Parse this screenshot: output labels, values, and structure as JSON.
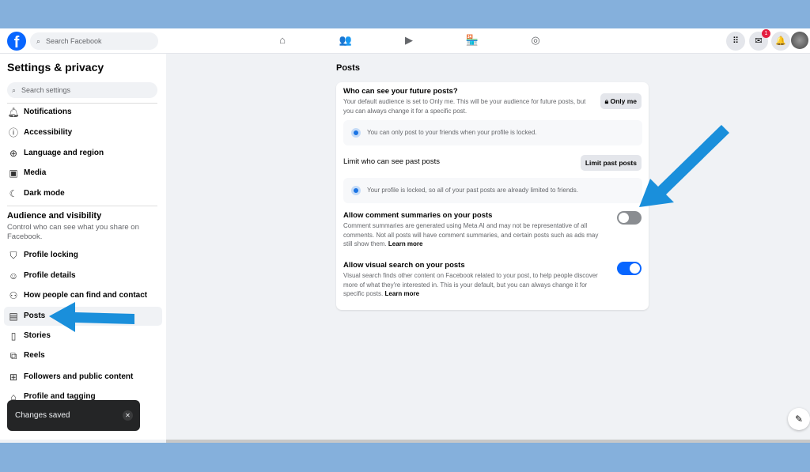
{
  "header": {
    "search_placeholder": "Search Facebook",
    "messenger_badge": "1"
  },
  "sidebar": {
    "title": "Settings & privacy",
    "search_placeholder": "Search settings",
    "items": [
      {
        "label": "Notifications",
        "icon": "bell"
      },
      {
        "label": "Accessibility",
        "icon": "accessibility"
      },
      {
        "label": "Language and region",
        "icon": "globe"
      },
      {
        "label": "Media",
        "icon": "media"
      },
      {
        "label": "Dark mode",
        "icon": "moon"
      }
    ],
    "section": {
      "title": "Audience and visibility",
      "subtitle": "Control who can see what you share on Facebook."
    },
    "section_items": [
      {
        "label": "Profile locking",
        "icon": "shield"
      },
      {
        "label": "Profile details",
        "icon": "person-circle"
      },
      {
        "label": "How people can find and contact you",
        "icon": "people"
      },
      {
        "label": "Posts",
        "icon": "posts",
        "active": true
      },
      {
        "label": "Stories",
        "icon": "book"
      },
      {
        "label": "Reels",
        "icon": "reels"
      },
      {
        "label": "Followers and public content",
        "icon": "plus-box"
      },
      {
        "label": "Profile and tagging",
        "icon": "tag"
      }
    ]
  },
  "toast": {
    "text": "Changes saved"
  },
  "main": {
    "title": "Posts",
    "future": {
      "heading": "Who can see your future posts?",
      "desc": "Your default audience is set to Only me. This will be your audience for future posts, but you can always change it for a specific post.",
      "button": "Only me",
      "info": "You can only post to your friends when your profile is locked."
    },
    "past": {
      "heading": "Limit who can see past posts",
      "button": "Limit past posts",
      "info": "Your profile is locked, so all of your past posts are already limited to friends."
    },
    "comment_summaries": {
      "heading": "Allow comment summaries on your posts",
      "desc": "Comment summaries are generated using Meta AI and may not be representative of all comments. Not all posts will have comment summaries, and certain posts such as ads may still show them.",
      "link": "Learn more",
      "enabled": false
    },
    "visual_search": {
      "heading": "Allow visual search on your posts",
      "desc": "Visual search finds other content on Facebook related to your post, to help people discover more of what they're interested in. This is your default, but you can always change it for specific posts.",
      "link": "Learn more",
      "enabled": true
    }
  },
  "colors": {
    "accent": "#0866ff",
    "annotation_arrow": "#1a8fdb",
    "frame_band": "#85b0dc"
  }
}
